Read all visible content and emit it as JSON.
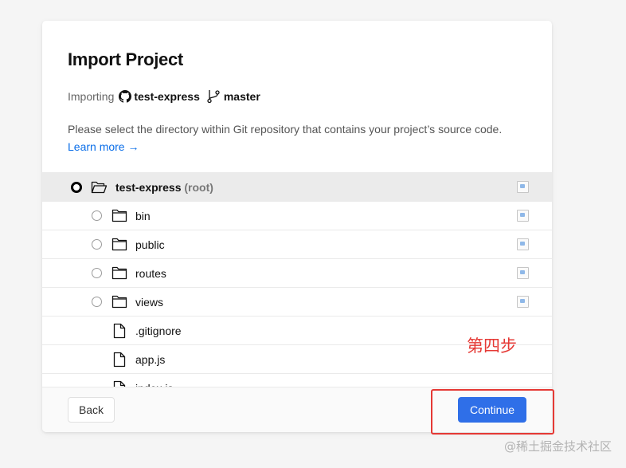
{
  "dialog": {
    "title": "Import Project",
    "importing_label": "Importing",
    "repo_icon": "github-icon",
    "repo": "test-express",
    "branch_icon": "git-branch-icon",
    "branch": "master",
    "description": "Please select the directory within Git repository that contains your project’s source code.",
    "learn_more": "Learn more →"
  },
  "tree": {
    "root": {
      "name": "test-express",
      "suffix": "(root)",
      "selected": true,
      "icon": "folder-open-icon"
    },
    "folders": [
      {
        "name": "bin",
        "icon": "folder-icon"
      },
      {
        "name": "public",
        "icon": "folder-icon"
      },
      {
        "name": "routes",
        "icon": "folder-icon"
      },
      {
        "name": "views",
        "icon": "folder-icon"
      }
    ],
    "files": [
      {
        "name": ".gitignore",
        "icon": "file-icon"
      },
      {
        "name": "app.js",
        "icon": "file-icon"
      },
      {
        "name": "index.js",
        "icon": "file-icon"
      }
    ]
  },
  "footer": {
    "back_label": "Back",
    "continue_label": "Continue"
  },
  "annotation": "第四步",
  "watermark": "@稀土掘金技术社区",
  "colors": {
    "primary": "#2f6fe8",
    "link": "#0b6ee8",
    "annotation_red": "#e53935",
    "selected_row": "#ebebeb"
  }
}
